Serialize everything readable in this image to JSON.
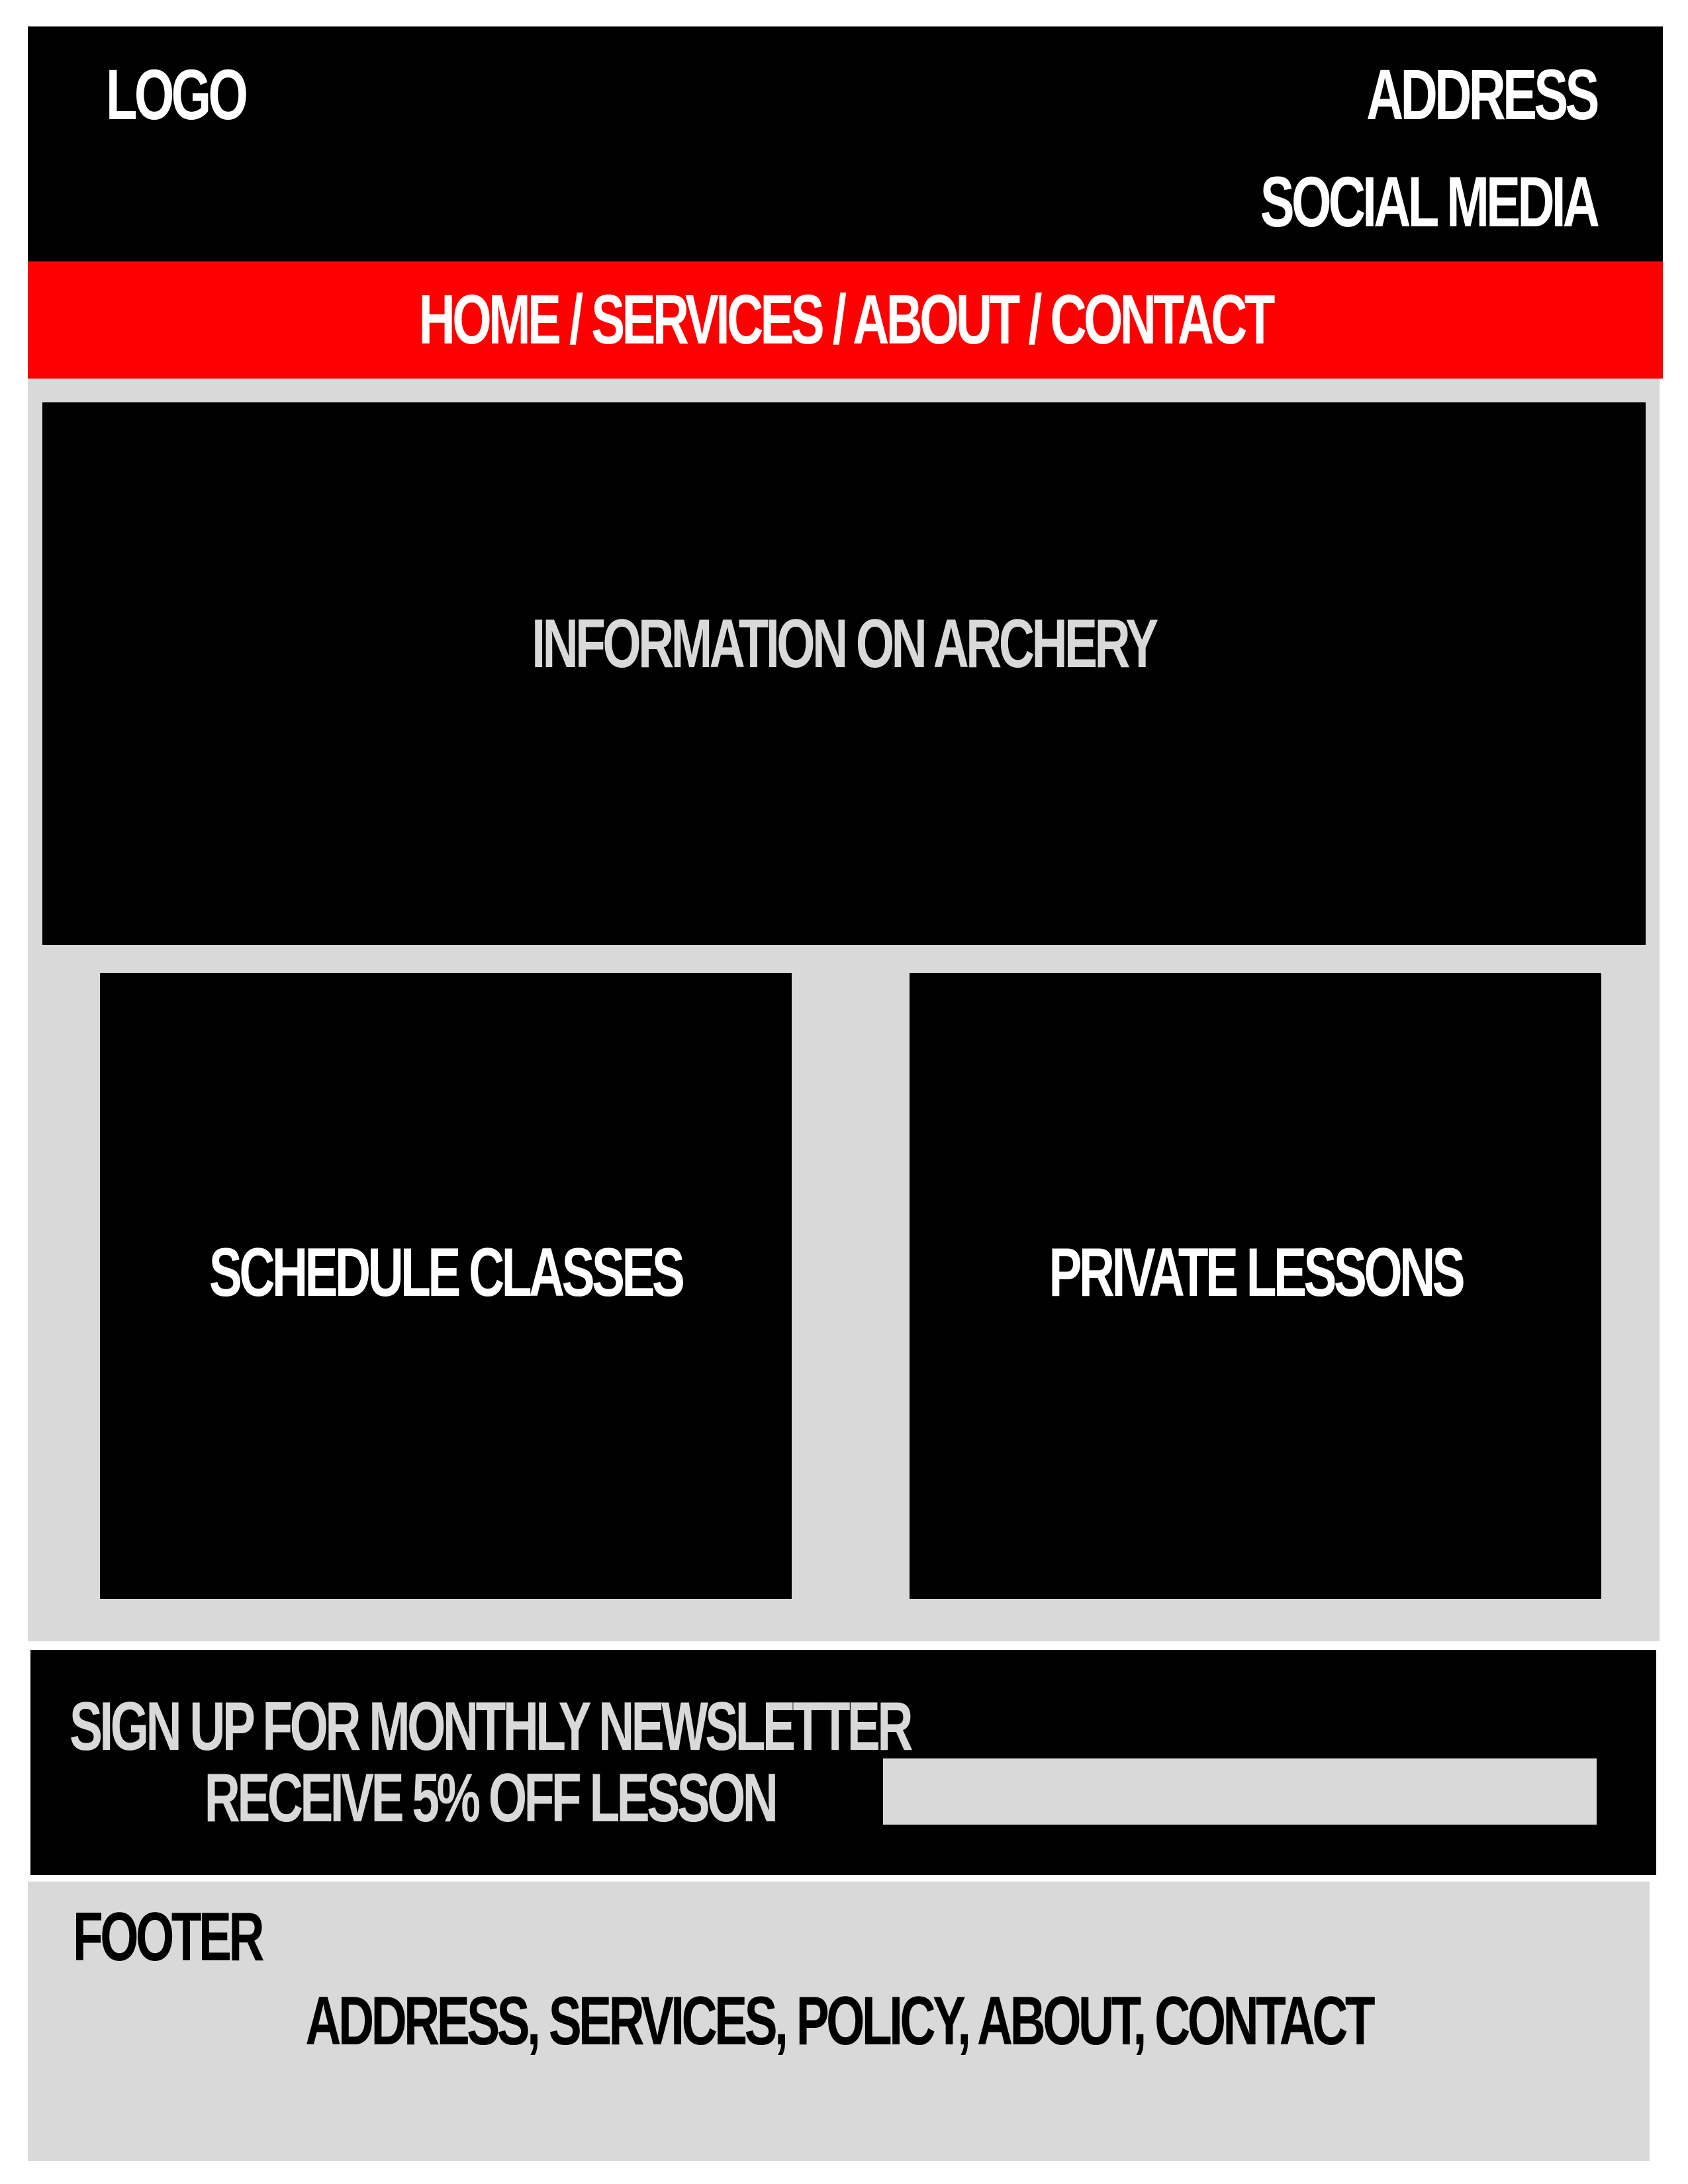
{
  "header": {
    "logo": "LOGO",
    "address": "ADDRESS",
    "social_media": "SOCIAL MEDIA"
  },
  "nav": {
    "links": "HOME / SERVICES / ABOUT / CONTACT"
  },
  "hero": {
    "label": "INFORMATION ON ARCHERY"
  },
  "cards": [
    {
      "label": "SCHEDULE CLASSES"
    },
    {
      "label": "PRIVATE LESSONS"
    }
  ],
  "newsletter": {
    "line1": "SIGN UP FOR MONTHLY NEWSLETTER",
    "line2": "RECEIVE 5% OFF LESSON",
    "input_value": ""
  },
  "footer": {
    "title": "FOOTER",
    "links": "ADDRESS, SERVICES, POLICY, ABOUT, CONTACT"
  },
  "colors": {
    "black": "#000000",
    "red": "#ff0000",
    "gray": "#d9d9d9",
    "white": "#ffffff"
  }
}
